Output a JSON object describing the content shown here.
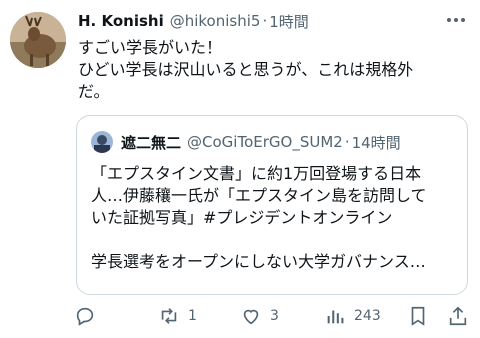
{
  "tweet": {
    "display_name": "H. Konishi",
    "handle": "@hikonishi5",
    "dot": "·",
    "time": "1時間",
    "text_lines": [
      "すごい学長がいた！",
      "ひどい学長は沢山いると思うが、これは規格外",
      "だ。"
    ]
  },
  "quote": {
    "display_name": "遮二無二",
    "handle": "@CoGiToErGO_SUM2",
    "dot": "·",
    "time": "14時間",
    "text_lines": [
      "「エプスタイン文書」に約1万回登場する日本",
      "人…伊藤穰一氏が「エプスタイン島を訪問して",
      "いた証拠写真」#プレジデントオンライン",
      "",
      "学長選考をオープンにしない大学ガバナンス…"
    ]
  },
  "actions": {
    "reply_count": "",
    "retweet_count": "1",
    "like_count": "3",
    "views_count": "243"
  },
  "icons": [
    "more-icon",
    "reply-icon",
    "retweet-icon",
    "like-icon",
    "views-icon",
    "bookmark-icon",
    "share-icon"
  ],
  "colors": {
    "text": "#0f1419",
    "secondary": "#536471",
    "border": "#cfd9de"
  }
}
